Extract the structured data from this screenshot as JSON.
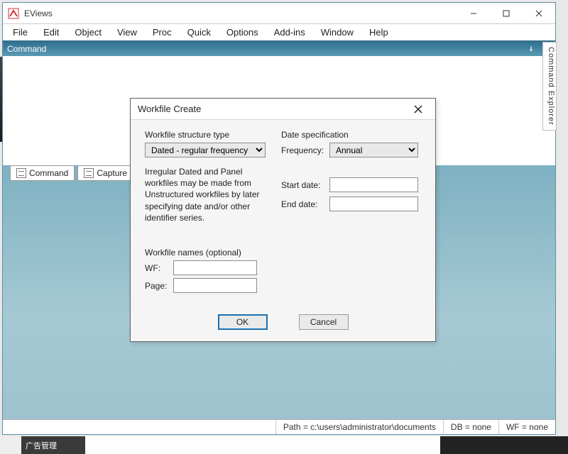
{
  "titlebar": {
    "app_name": "EViews"
  },
  "menu": {
    "items": [
      "File",
      "Edit",
      "Object",
      "View",
      "Proc",
      "Quick",
      "Options",
      "Add-ins",
      "Window",
      "Help"
    ]
  },
  "command_panel": {
    "title": "Command"
  },
  "cmd_tabs": {
    "command": "Command",
    "capture": "Capture"
  },
  "explorer": {
    "label": "Command Explorer"
  },
  "statusbar": {
    "path": "Path = c:\\users\\administrator\\documents",
    "db": "DB = none",
    "wf": "WF = none"
  },
  "dialog": {
    "title": "Workfile Create",
    "structure_label": "Workfile structure type",
    "structure_value": "Dated - regular frequency",
    "note": "Irregular Dated and Panel workfiles may be made from Unstructured workfiles by later specifying date and/or other identifier series.",
    "datespec_label": "Date specification",
    "frequency_label": "Frequency:",
    "frequency_value": "Annual",
    "start_label": "Start date:",
    "end_label": "End date:",
    "start_value": "",
    "end_value": "",
    "names_label": "Workfile names (optional)",
    "wf_label": "WF:",
    "page_label": "Page:",
    "wf_value": "",
    "page_value": "",
    "ok": "OK",
    "cancel": "Cancel"
  },
  "crop_label": "广告管理"
}
